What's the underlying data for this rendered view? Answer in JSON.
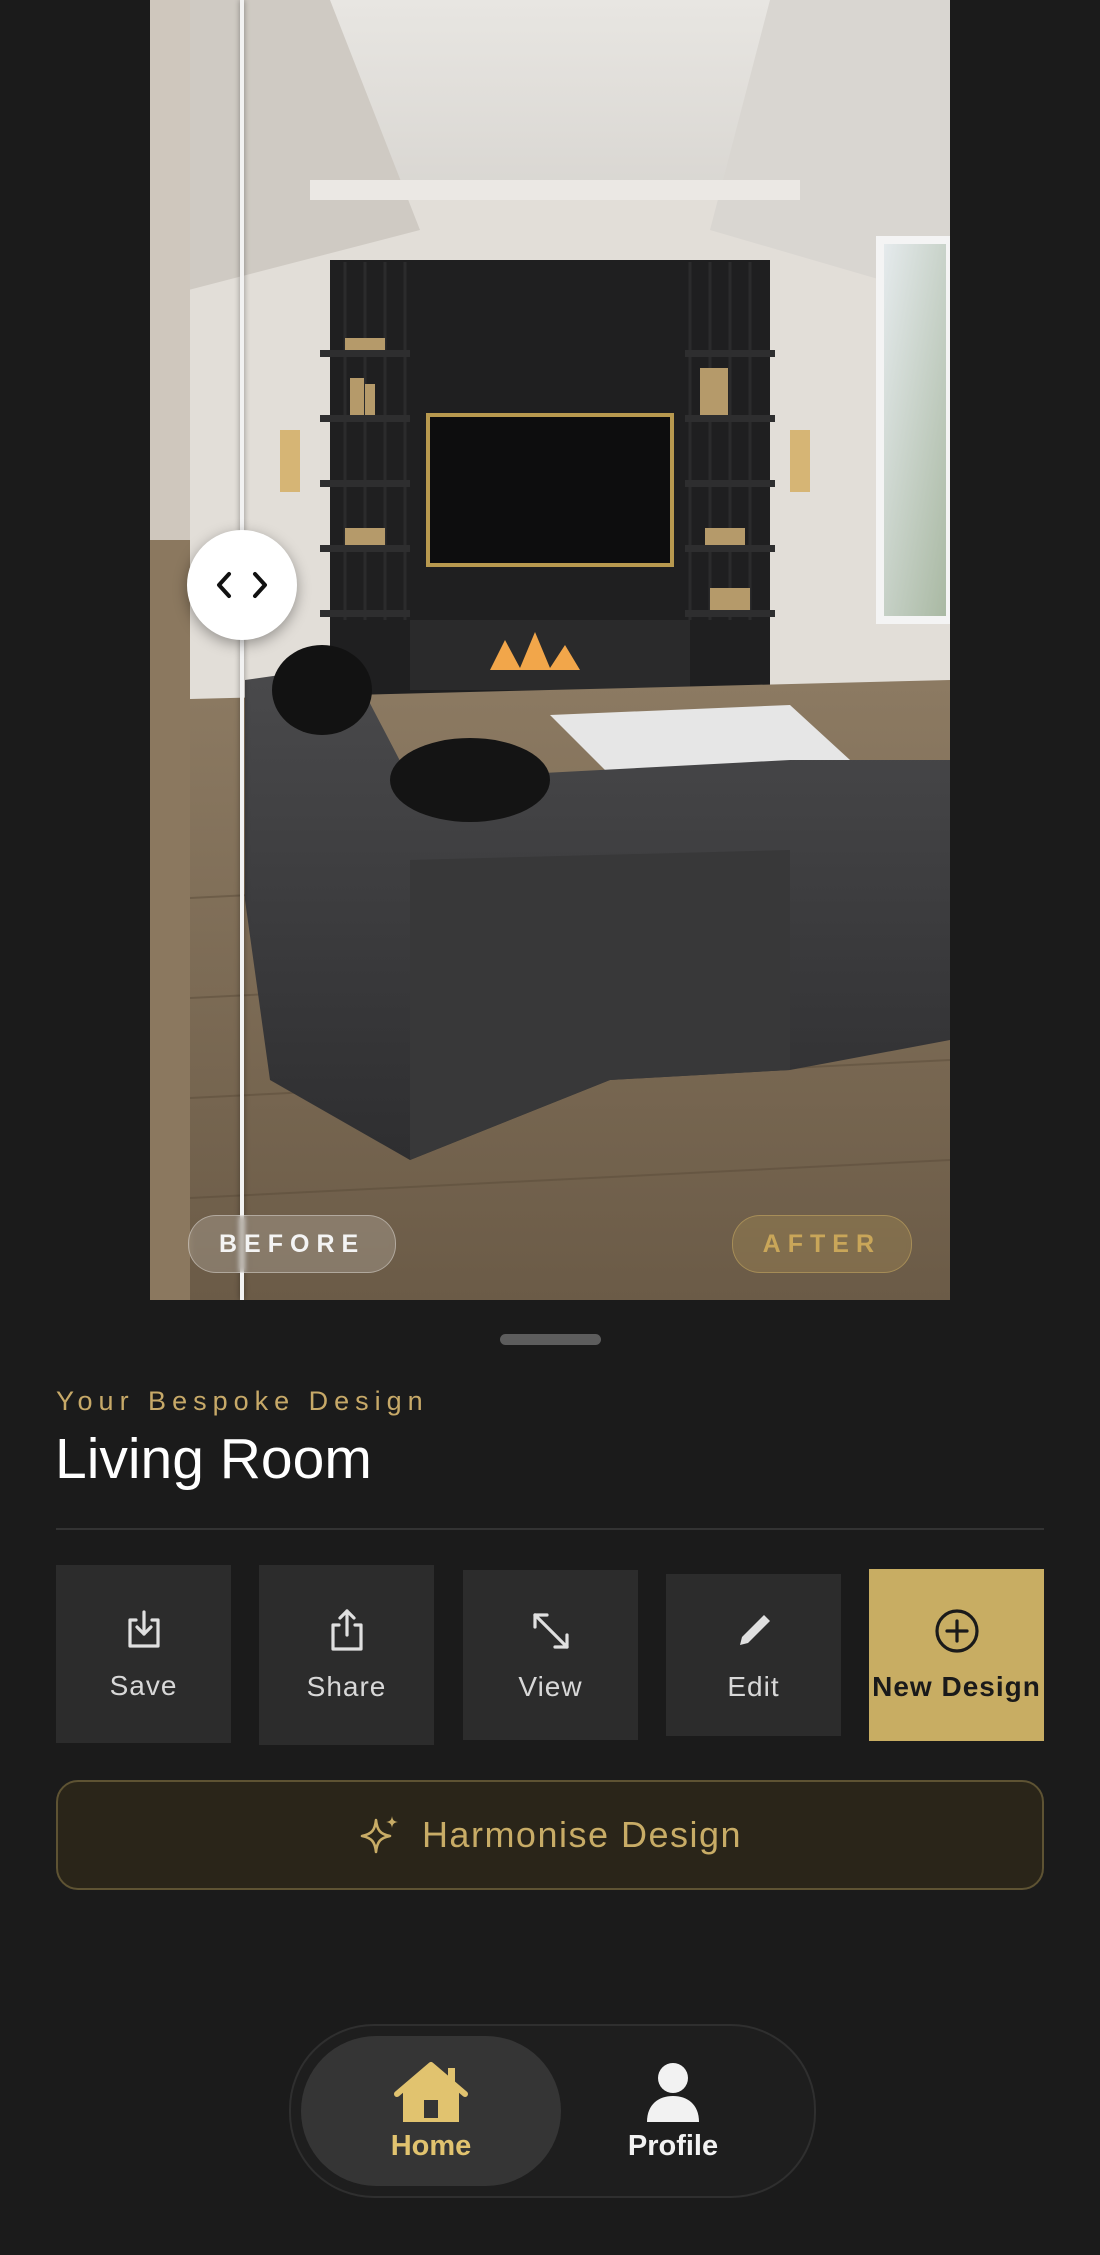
{
  "compare": {
    "before_label": "BEFORE",
    "after_label": "AFTER",
    "handle_icon": "chevron-left-right-icon"
  },
  "design": {
    "eyebrow": "Your Bespoke Design",
    "room_name": "Living Room"
  },
  "actions": [
    {
      "label": "Save",
      "icon": "download-icon"
    },
    {
      "label": "Share",
      "icon": "share-icon"
    },
    {
      "label": "View",
      "icon": "expand-icon"
    },
    {
      "label": "Edit",
      "icon": "pencil-icon"
    },
    {
      "label": "New Design",
      "icon": "plus-circle-icon"
    }
  ],
  "harmonise": {
    "label": "Harmonise Design",
    "icon": "sparkles-icon"
  },
  "nav": {
    "home_label": "Home",
    "profile_label": "Profile",
    "active": "Home"
  },
  "colors": {
    "accent_gold": "#c8ad63",
    "background": "#1b1b1b",
    "tile": "#2c2c2c"
  }
}
